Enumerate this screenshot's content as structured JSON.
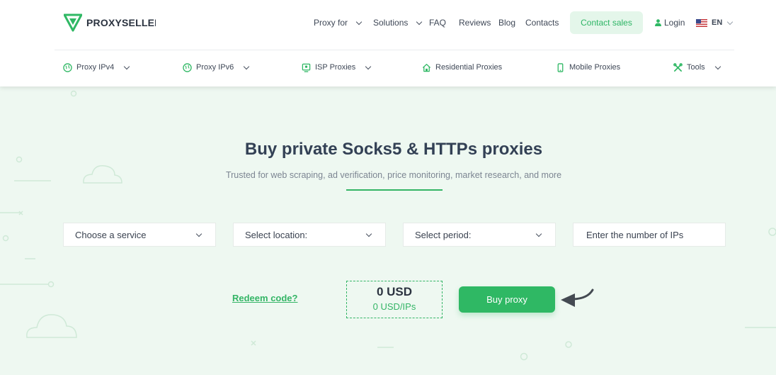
{
  "brand": {
    "name": "PROXYSELLER"
  },
  "top_nav": {
    "items": [
      {
        "label": "Proxy for",
        "dropdown": true
      },
      {
        "label": "Solutions",
        "dropdown": true
      },
      {
        "label": "FAQ",
        "dropdown": false
      },
      {
        "label": "Reviews",
        "dropdown": false
      },
      {
        "label": "Blog",
        "dropdown": false
      },
      {
        "label": "Contacts",
        "dropdown": false
      }
    ],
    "contact_sales": "Contact sales",
    "login": "Login",
    "language": "EN"
  },
  "sub_nav": {
    "items": [
      {
        "label": "Proxy IPv4",
        "icon": "globe-icon",
        "dropdown": true
      },
      {
        "label": "Proxy IPv6",
        "icon": "globe-icon",
        "dropdown": true
      },
      {
        "label": "ISP Proxies",
        "icon": "isp-icon",
        "dropdown": true
      },
      {
        "label": "Residential Proxies",
        "icon": "home-icon",
        "dropdown": false
      },
      {
        "label": "Mobile Proxies",
        "icon": "mobile-icon",
        "dropdown": false
      },
      {
        "label": "Tools",
        "icon": "tools-icon",
        "dropdown": true
      }
    ]
  },
  "hero": {
    "title": "Buy private Socks5 & HTTPs proxies",
    "subtitle": "Trusted for web scraping, ad verification, price monitoring, market research, and more"
  },
  "form": {
    "service": "Choose a service",
    "location": "Select location:",
    "period": "Select period:",
    "ips_placeholder": "Enter the number of IPs"
  },
  "checkout": {
    "redeem_label": "Redeem code?",
    "total": "0 USD",
    "per_ip": "0 USD/IPs",
    "buy_label": "Buy proxy"
  },
  "colors": {
    "accent": "#2fb864",
    "hero_background": "#eef8f1",
    "text_dark": "#334155"
  }
}
